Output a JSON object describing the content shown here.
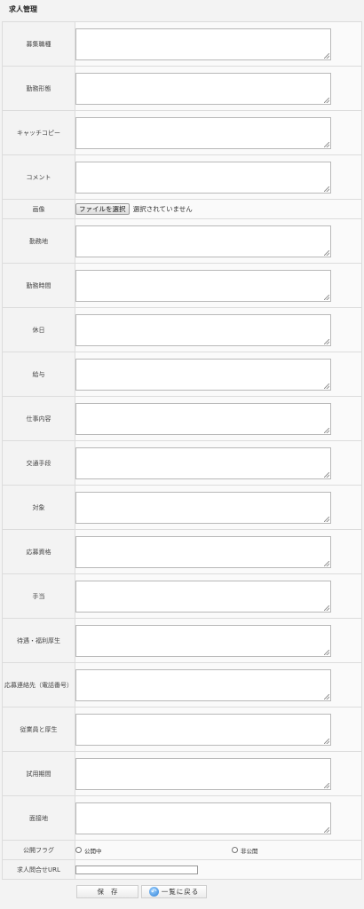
{
  "page": {
    "title": "求人管理"
  },
  "fields_top": [
    {
      "label": "募集職種"
    },
    {
      "label": "勤務形態"
    },
    {
      "label": "キャッチコピー"
    },
    {
      "label": "コメント"
    }
  ],
  "image_field": {
    "label": "画像",
    "button_label": "ファイルを選択",
    "status": "選択されていません"
  },
  "fields_bottom": [
    {
      "label": "勤務地"
    },
    {
      "label": "勤務時間"
    },
    {
      "label": "休日"
    },
    {
      "label": "給与"
    },
    {
      "label": "仕事内容"
    },
    {
      "label": "交通手段"
    },
    {
      "label": "対象"
    },
    {
      "label": "応募資格"
    },
    {
      "label": "手当"
    },
    {
      "label": "待遇・福利厚生"
    },
    {
      "label": "応募連絡先（電話番号）"
    },
    {
      "label": "従業員と厚生"
    },
    {
      "label": "試用期間"
    },
    {
      "label": "面接地"
    }
  ],
  "publish": {
    "label": "公開フラグ",
    "options": [
      "公開中",
      "非公開"
    ],
    "selected": null
  },
  "inquiry_url": {
    "label": "求人問合せURL",
    "value": ""
  },
  "actions": {
    "save_label": "保存",
    "back_label": "一覧に戻る"
  }
}
